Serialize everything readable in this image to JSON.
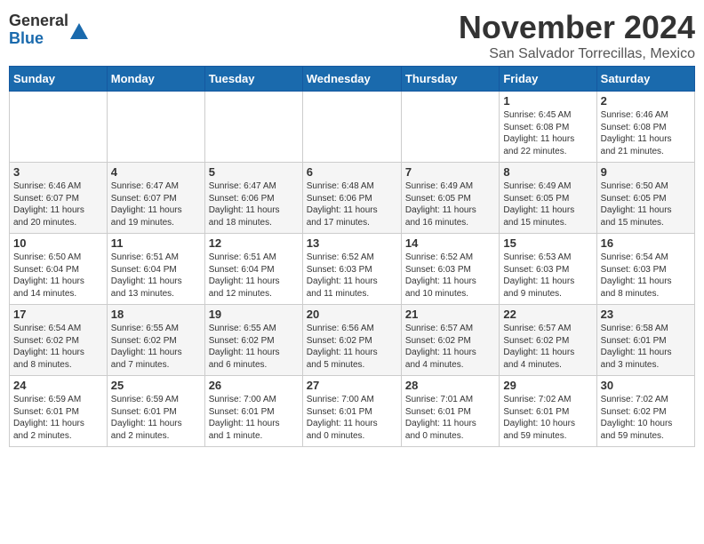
{
  "logo": {
    "general": "General",
    "blue": "Blue"
  },
  "title": "November 2024",
  "subtitle": "San Salvador Torrecillas, Mexico",
  "weekdays": [
    "Sunday",
    "Monday",
    "Tuesday",
    "Wednesday",
    "Thursday",
    "Friday",
    "Saturday"
  ],
  "weeks": [
    [
      {
        "day": "",
        "info": ""
      },
      {
        "day": "",
        "info": ""
      },
      {
        "day": "",
        "info": ""
      },
      {
        "day": "",
        "info": ""
      },
      {
        "day": "",
        "info": ""
      },
      {
        "day": "1",
        "info": "Sunrise: 6:45 AM\nSunset: 6:08 PM\nDaylight: 11 hours\nand 22 minutes."
      },
      {
        "day": "2",
        "info": "Sunrise: 6:46 AM\nSunset: 6:08 PM\nDaylight: 11 hours\nand 21 minutes."
      }
    ],
    [
      {
        "day": "3",
        "info": "Sunrise: 6:46 AM\nSunset: 6:07 PM\nDaylight: 11 hours\nand 20 minutes."
      },
      {
        "day": "4",
        "info": "Sunrise: 6:47 AM\nSunset: 6:07 PM\nDaylight: 11 hours\nand 19 minutes."
      },
      {
        "day": "5",
        "info": "Sunrise: 6:47 AM\nSunset: 6:06 PM\nDaylight: 11 hours\nand 18 minutes."
      },
      {
        "day": "6",
        "info": "Sunrise: 6:48 AM\nSunset: 6:06 PM\nDaylight: 11 hours\nand 17 minutes."
      },
      {
        "day": "7",
        "info": "Sunrise: 6:49 AM\nSunset: 6:05 PM\nDaylight: 11 hours\nand 16 minutes."
      },
      {
        "day": "8",
        "info": "Sunrise: 6:49 AM\nSunset: 6:05 PM\nDaylight: 11 hours\nand 15 minutes."
      },
      {
        "day": "9",
        "info": "Sunrise: 6:50 AM\nSunset: 6:05 PM\nDaylight: 11 hours\nand 15 minutes."
      }
    ],
    [
      {
        "day": "10",
        "info": "Sunrise: 6:50 AM\nSunset: 6:04 PM\nDaylight: 11 hours\nand 14 minutes."
      },
      {
        "day": "11",
        "info": "Sunrise: 6:51 AM\nSunset: 6:04 PM\nDaylight: 11 hours\nand 13 minutes."
      },
      {
        "day": "12",
        "info": "Sunrise: 6:51 AM\nSunset: 6:04 PM\nDaylight: 11 hours\nand 12 minutes."
      },
      {
        "day": "13",
        "info": "Sunrise: 6:52 AM\nSunset: 6:03 PM\nDaylight: 11 hours\nand 11 minutes."
      },
      {
        "day": "14",
        "info": "Sunrise: 6:52 AM\nSunset: 6:03 PM\nDaylight: 11 hours\nand 10 minutes."
      },
      {
        "day": "15",
        "info": "Sunrise: 6:53 AM\nSunset: 6:03 PM\nDaylight: 11 hours\nand 9 minutes."
      },
      {
        "day": "16",
        "info": "Sunrise: 6:54 AM\nSunset: 6:03 PM\nDaylight: 11 hours\nand 8 minutes."
      }
    ],
    [
      {
        "day": "17",
        "info": "Sunrise: 6:54 AM\nSunset: 6:02 PM\nDaylight: 11 hours\nand 8 minutes."
      },
      {
        "day": "18",
        "info": "Sunrise: 6:55 AM\nSunset: 6:02 PM\nDaylight: 11 hours\nand 7 minutes."
      },
      {
        "day": "19",
        "info": "Sunrise: 6:55 AM\nSunset: 6:02 PM\nDaylight: 11 hours\nand 6 minutes."
      },
      {
        "day": "20",
        "info": "Sunrise: 6:56 AM\nSunset: 6:02 PM\nDaylight: 11 hours\nand 5 minutes."
      },
      {
        "day": "21",
        "info": "Sunrise: 6:57 AM\nSunset: 6:02 PM\nDaylight: 11 hours\nand 4 minutes."
      },
      {
        "day": "22",
        "info": "Sunrise: 6:57 AM\nSunset: 6:02 PM\nDaylight: 11 hours\nand 4 minutes."
      },
      {
        "day": "23",
        "info": "Sunrise: 6:58 AM\nSunset: 6:01 PM\nDaylight: 11 hours\nand 3 minutes."
      }
    ],
    [
      {
        "day": "24",
        "info": "Sunrise: 6:59 AM\nSunset: 6:01 PM\nDaylight: 11 hours\nand 2 minutes."
      },
      {
        "day": "25",
        "info": "Sunrise: 6:59 AM\nSunset: 6:01 PM\nDaylight: 11 hours\nand 2 minutes."
      },
      {
        "day": "26",
        "info": "Sunrise: 7:00 AM\nSunset: 6:01 PM\nDaylight: 11 hours\nand 1 minute."
      },
      {
        "day": "27",
        "info": "Sunrise: 7:00 AM\nSunset: 6:01 PM\nDaylight: 11 hours\nand 0 minutes."
      },
      {
        "day": "28",
        "info": "Sunrise: 7:01 AM\nSunset: 6:01 PM\nDaylight: 11 hours\nand 0 minutes."
      },
      {
        "day": "29",
        "info": "Sunrise: 7:02 AM\nSunset: 6:01 PM\nDaylight: 10 hours\nand 59 minutes."
      },
      {
        "day": "30",
        "info": "Sunrise: 7:02 AM\nSunset: 6:02 PM\nDaylight: 10 hours\nand 59 minutes."
      }
    ]
  ]
}
